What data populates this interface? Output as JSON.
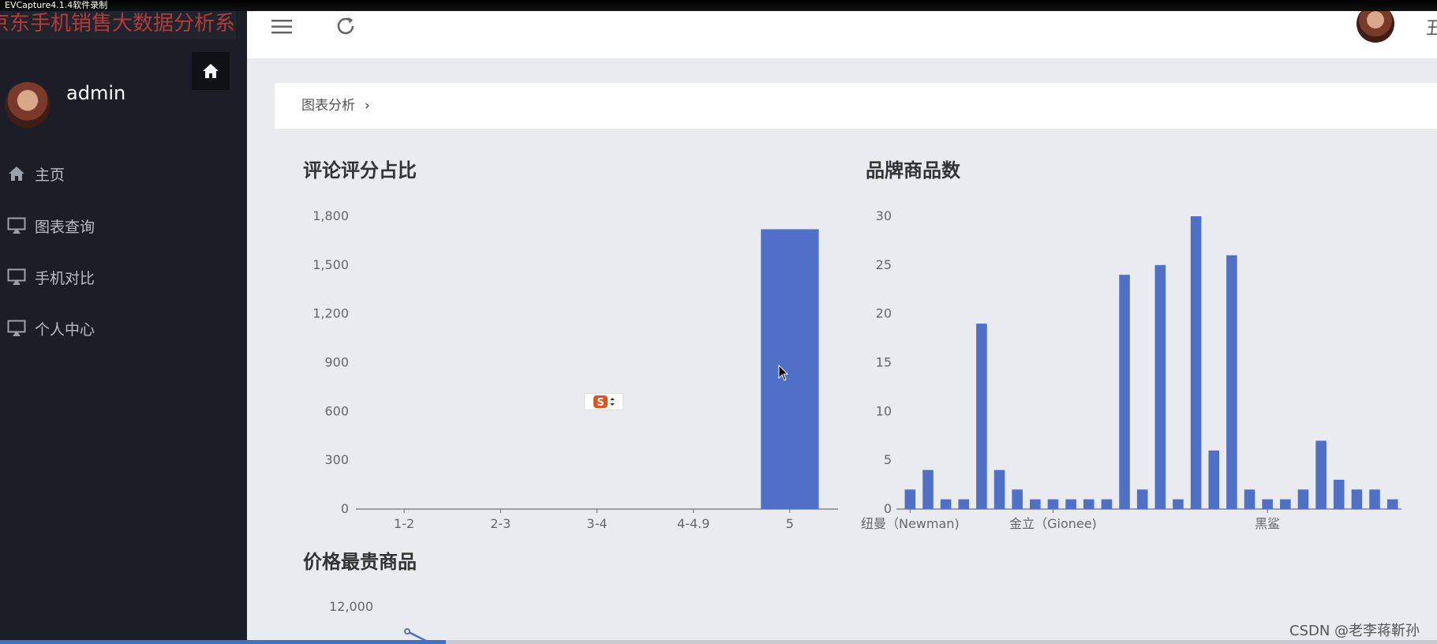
{
  "recorder": {
    "label": "EVCapture4.1.4软件录制"
  },
  "app": {
    "title": "京东手机销售大数据分析系统"
  },
  "sidebar": {
    "user": "admin",
    "items": [
      {
        "label": "主页",
        "icon": "home-icon"
      },
      {
        "label": "图表查询",
        "icon": "monitor-icon"
      },
      {
        "label": "手机对比",
        "icon": "monitor-icon"
      },
      {
        "label": "个人中心",
        "icon": "monitor-icon"
      }
    ]
  },
  "topbar": {
    "menu_icon": "hamburger-icon",
    "refresh_icon": "refresh-icon",
    "right_glyph": "丑"
  },
  "breadcrumb": {
    "label": "图表分析",
    "separator": "›"
  },
  "colors": {
    "bar": "#5070c8",
    "sidebar": "#1b1e26",
    "content_bg": "#e9ebee"
  },
  "charts": {
    "rating": {
      "title": "评论评分占比"
    },
    "brand": {
      "title": "品牌商品数"
    },
    "price": {
      "title": "价格最贵商品"
    }
  },
  "chart_data": [
    {
      "type": "bar",
      "title": "评论评分占比",
      "categories": [
        "1-2",
        "2-3",
        "3-4",
        "4-4.9",
        "5"
      ],
      "values": [
        0,
        0,
        0,
        0,
        1720
      ],
      "ylim": [
        0,
        1800
      ],
      "yticks": [
        "0",
        "300",
        "600",
        "900",
        "1,200",
        "1,500",
        "1,800"
      ]
    },
    {
      "type": "bar",
      "title": "品牌商品数",
      "xtick_labels": [
        "纽曼（Newman)",
        "金立（Gionee)",
        "黑鲨"
      ],
      "xtick_indices": [
        0,
        8,
        20
      ],
      "values": [
        2,
        4,
        1,
        1,
        19,
        4,
        2,
        1,
        1,
        1,
        1,
        1,
        24,
        2,
        25,
        1,
        30,
        6,
        26,
        2,
        1,
        1,
        2,
        7,
        3,
        2,
        2,
        1
      ],
      "ylim": [
        0,
        30
      ],
      "yticks": [
        "0",
        "5",
        "10",
        "15",
        "20",
        "25",
        "30"
      ]
    },
    {
      "type": "line",
      "title": "价格最贵商品",
      "yticks": [
        "12,000"
      ]
    }
  ],
  "watermark": {
    "text": "CSDN @老李蒋靳孙"
  }
}
